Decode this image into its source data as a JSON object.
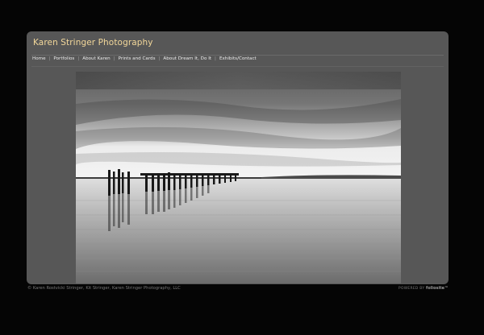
{
  "site": {
    "title": "Karen Stringer Photography"
  },
  "nav": {
    "items": [
      {
        "label": "Home"
      },
      {
        "label": "Portfolios"
      },
      {
        "label": "About Karen"
      },
      {
        "label": "Prints and Cards"
      },
      {
        "label": "About Dream It, Do It"
      },
      {
        "label": "Exhibits/Contact"
      }
    ],
    "separator": "|"
  },
  "photo": {
    "subject": "black-and-white photo of old pier pilings in calm water"
  },
  "footer": {
    "copyright": "© Karen Rostvicki Stringer, Kit Stringer, Karen Stringer Photography, LLC",
    "powered_prefix": "POWERED BY",
    "powered_brand": "folio",
    "powered_suffix": "site™"
  },
  "colors": {
    "page_background": "#050505",
    "panel": "#575757",
    "title": "#f2d79a",
    "nav_text": "#ececec"
  }
}
